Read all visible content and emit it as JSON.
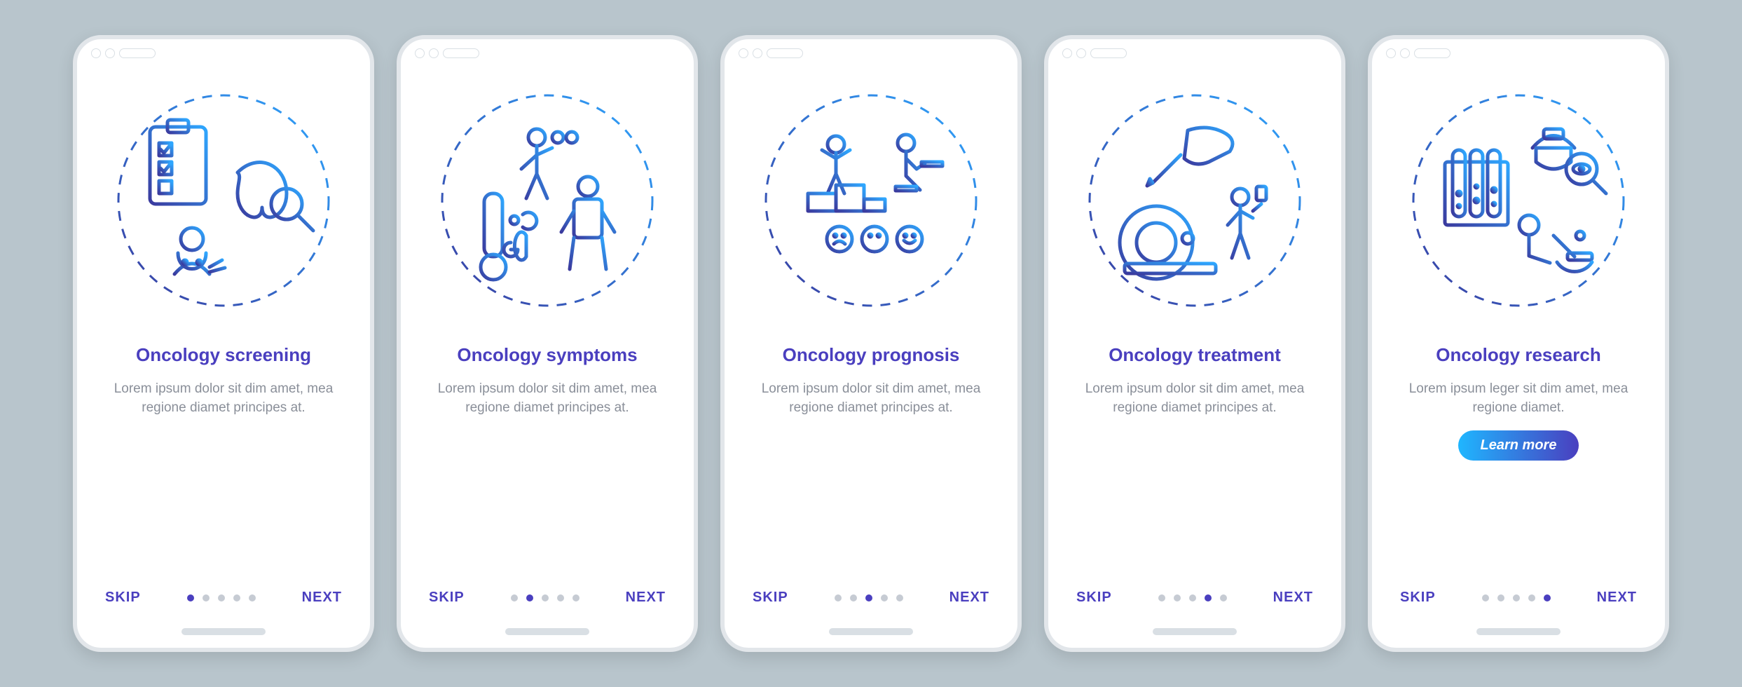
{
  "common": {
    "skip_label": "SKIP",
    "next_label": "NEXT",
    "learn_more_label": "Learn more",
    "dot_count": 5
  },
  "screens": [
    {
      "icon": "screening",
      "title": "Oncology screening",
      "body": "Lorem ipsum dolor sit dim amet, mea regione diamet principes at.",
      "active_dot": 0,
      "show_cta": false
    },
    {
      "icon": "symptoms",
      "title": "Oncology symptoms",
      "body": "Lorem ipsum dolor sit dim amet, mea regione diamet principes at.",
      "active_dot": 1,
      "show_cta": false
    },
    {
      "icon": "prognosis",
      "title": "Oncology prognosis",
      "body": "Lorem ipsum dolor sit dim amet, mea regione diamet principes at.",
      "active_dot": 2,
      "show_cta": false
    },
    {
      "icon": "treatment",
      "title": "Oncology treatment",
      "body": "Lorem ipsum dolor sit dim amet, mea regione diamet principes at.",
      "active_dot": 3,
      "show_cta": false
    },
    {
      "icon": "research",
      "title": "Oncology research",
      "body": "Lorem ipsum leger sit dim amet, mea regione diamet.",
      "active_dot": 4,
      "show_cta": true
    }
  ]
}
